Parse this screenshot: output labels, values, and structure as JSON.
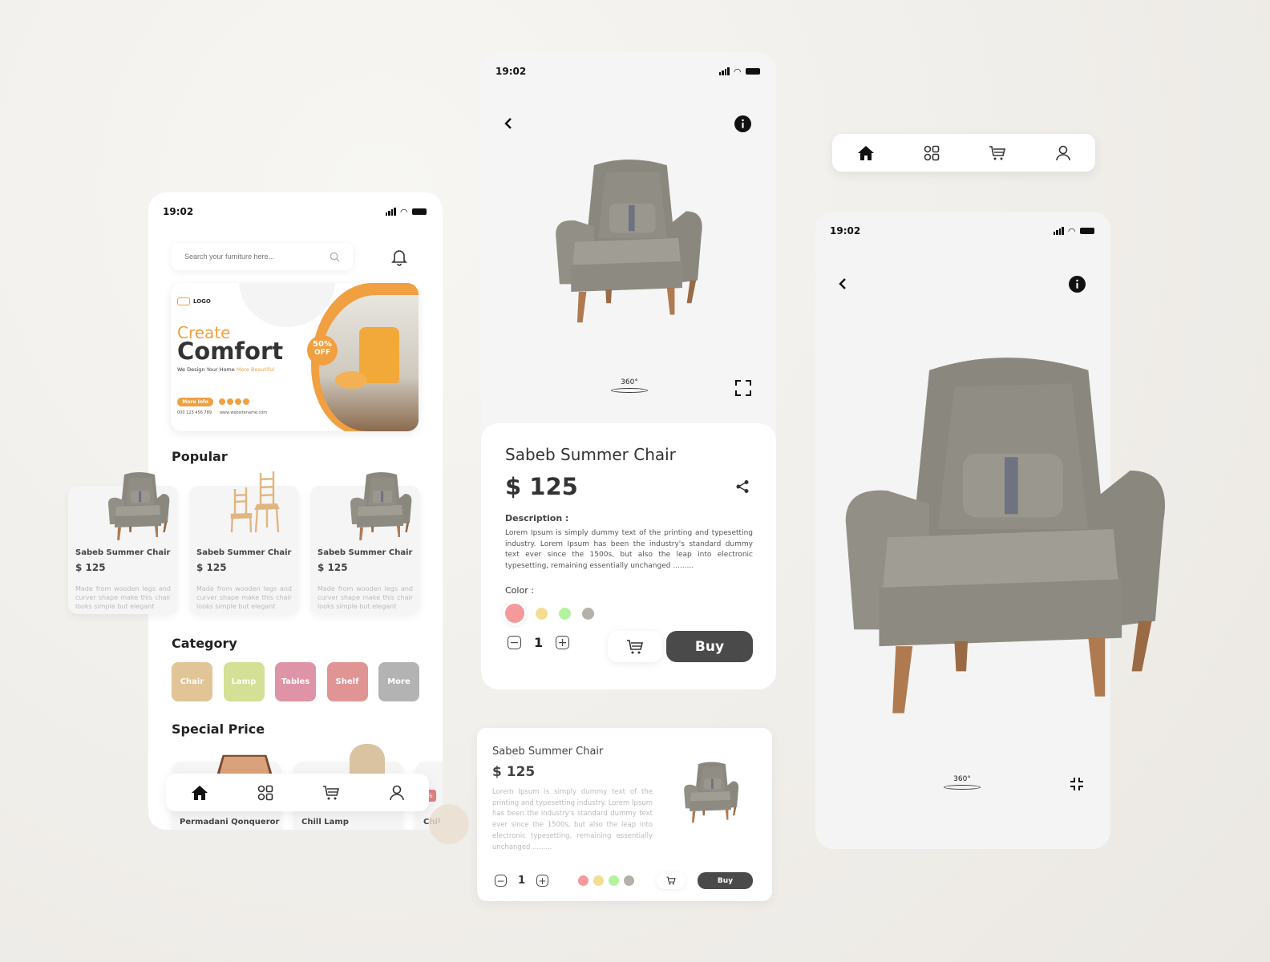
{
  "status_time": "19:02",
  "home": {
    "search_placeholder": "Search your furniture here...",
    "banner": {
      "logo": "LOGO",
      "line1": "Create",
      "line2": "Comfort",
      "tagline": "We Design Your Home",
      "tagline_accent": "More Beautiful",
      "badge_pct": "50%",
      "badge_off": "OFF",
      "button": "More Info",
      "phone": "000 123 456 789",
      "website": "www.websitename.com"
    },
    "popular_title": "Popular",
    "popular": [
      {
        "name": "Sabeb Summer Chair",
        "price": "$ 125",
        "desc": "Made from wooden legs and curver shape make this chair looks simple but elegant"
      },
      {
        "name": "Sabeb Summer Chair",
        "price": "$ 125",
        "desc": "Made from wooden legs and curver shape make this chair looks simple but elegant"
      },
      {
        "name": "Sabeb Summer Chair",
        "price": "$ 125",
        "desc": "Made from wooden legs and curver shape make this chair looks simple but elegant"
      }
    ],
    "category_title": "Category",
    "categories": [
      {
        "label": "Chair",
        "color": "#e2c596"
      },
      {
        "label": "Lamp",
        "color": "#d3e096"
      },
      {
        "label": "Tables",
        "color": "#de93a6"
      },
      {
        "label": "Shelf",
        "color": "#e09594"
      },
      {
        "label": "More",
        "color": "#b3b3b3"
      }
    ],
    "special_title": "Special Price",
    "special": [
      {
        "name": "Permadani Qonqueror"
      },
      {
        "name": "Chill Lamp"
      },
      {
        "name": "Chill",
        "badge": "%"
      }
    ]
  },
  "detail": {
    "rotate_label": "360°",
    "name": "Sabeb Summer Chair",
    "price": "$ 125",
    "description_label": "Description :",
    "description": "Lorem Ipsum is simply dummy text of the printing and typesetting industry. Lorem Ipsum has been the industry's standard dummy text ever since the 1500s, but also the leap into electronic typesetting, remaining essentially unchanged .........",
    "color_label": "Color :",
    "colors": [
      "#f49a9a",
      "#f2dd92",
      "#b2f39b",
      "#b5b0aa"
    ],
    "quantity": "1",
    "buy": "Buy"
  },
  "compact": {
    "name": "Sabeb Summer Chair",
    "price": "$ 125",
    "description": "Lorem Ipsum is simply dummy text of the printing and typesetting industry. Lorem Ipsum has been the industry's standard dummy text ever since the 1500s, but also the leap into electronic typesetting, remaining essentially unchanged .........",
    "quantity": "1",
    "buy": "Buy"
  },
  "fullview": {
    "rotate_label": "360°"
  },
  "icons": [
    "home-icon",
    "grid-icon",
    "cart-icon",
    "user-icon",
    "bell-icon",
    "search-icon",
    "back-icon",
    "info-icon",
    "share-icon",
    "expand-icon",
    "collapse-icon"
  ],
  "accent": "#f0a040"
}
